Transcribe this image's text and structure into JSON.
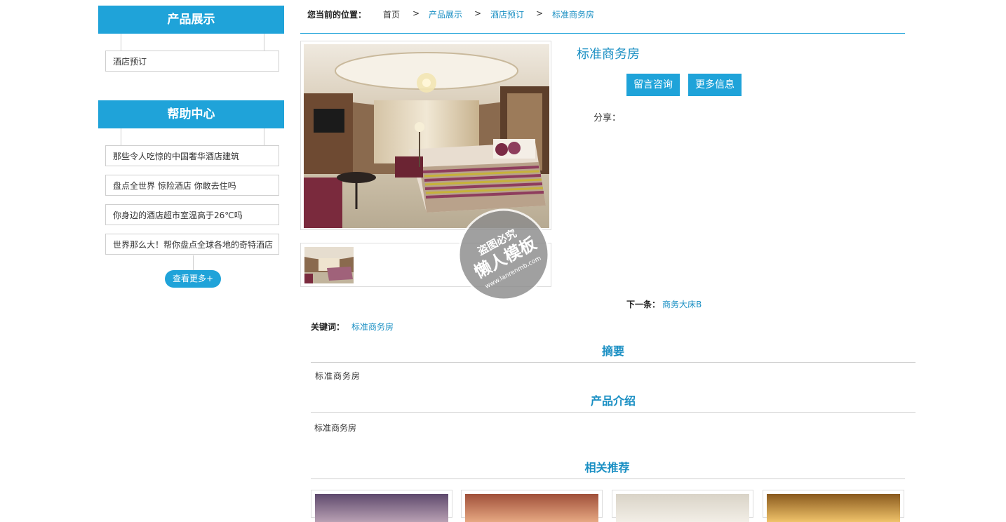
{
  "sidebar": {
    "products_title": "产品展示",
    "product_items": [
      {
        "label": "酒店预订"
      }
    ],
    "help_title": "帮助中心",
    "help_items": [
      {
        "label": "那些令人吃惊的中国奢华酒店建筑"
      },
      {
        "label": "盘点全世界 惊险酒店 你敢去住吗"
      },
      {
        "label": "你身边的酒店超市室温高于26℃吗"
      },
      {
        "label": "世界那么大！帮你盘点全球各地的奇特酒店"
      }
    ],
    "more_label": "查看更多+"
  },
  "breadcrumb": {
    "label": "您当前的位置：",
    "home": "首页",
    "separator": ">",
    "items": [
      "产品展示",
      "酒店预订",
      "标准商务房"
    ]
  },
  "product": {
    "title": "标准商务房",
    "inquiry_button": "留言咨询",
    "more_info_button": "更多信息",
    "share_label": "分享：",
    "next_label": "下一条：",
    "next_link": "商务大床B",
    "keywords_label": "关键词：",
    "keyword": "标准商务房"
  },
  "watermark": {
    "line1": "盗图必究",
    "line2": "懒人模板",
    "line3": "www.lanrenmb.com"
  },
  "sections": {
    "summary_title": "摘要",
    "summary_text": "标准商务房",
    "intro_title": "产品介绍",
    "intro_text": "标准商务房",
    "related_title": "相关推荐"
  },
  "colors": {
    "accent": "#1fa3d9",
    "link": "#1a8fc3",
    "border": "#cfcfcf"
  }
}
